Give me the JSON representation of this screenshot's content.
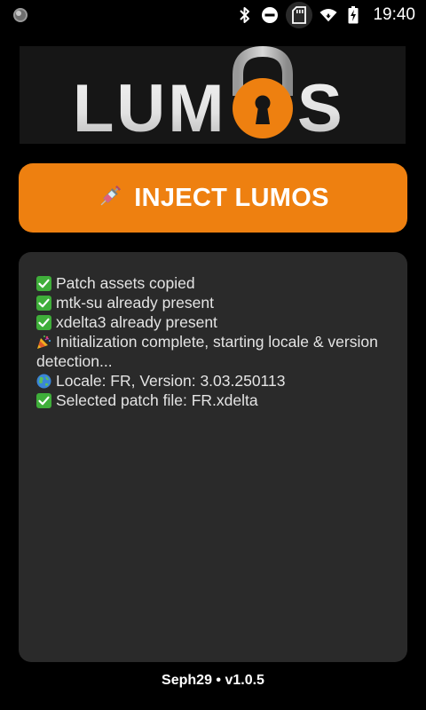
{
  "status_bar": {
    "time": "19:40",
    "icons": [
      "circle-indicator-icon",
      "bluetooth-icon",
      "do-not-disturb-icon",
      "sd-card-icon",
      "wifi-icon",
      "battery-charging-icon"
    ]
  },
  "logo": {
    "letters_left": "LUM",
    "letters_right": "S",
    "lock_icon": "padlock-icon"
  },
  "inject_button": {
    "label": "INJECT LUMOS",
    "icon": "syringe-icon"
  },
  "log": {
    "lines": [
      {
        "icon": "check-mark-icon",
        "text": "Patch assets copied"
      },
      {
        "icon": "check-mark-icon",
        "text": "mtk-su already present"
      },
      {
        "icon": "check-mark-icon",
        "text": "xdelta3 already present"
      },
      {
        "icon": "party-popper-icon",
        "text": "Initialization complete, starting locale & version detection..."
      },
      {
        "icon": "globe-icon",
        "text": "Locale: FR, Version: 3.03.250113"
      },
      {
        "icon": "check-mark-icon",
        "text": "Selected patch file: FR.xdelta"
      }
    ]
  },
  "footer": {
    "text": "Seph29 • v1.0.5"
  },
  "colors": {
    "accent": "#ee8010",
    "panel": "#2a2a2a",
    "background": "#000000",
    "check_green": "#3fae3a"
  }
}
